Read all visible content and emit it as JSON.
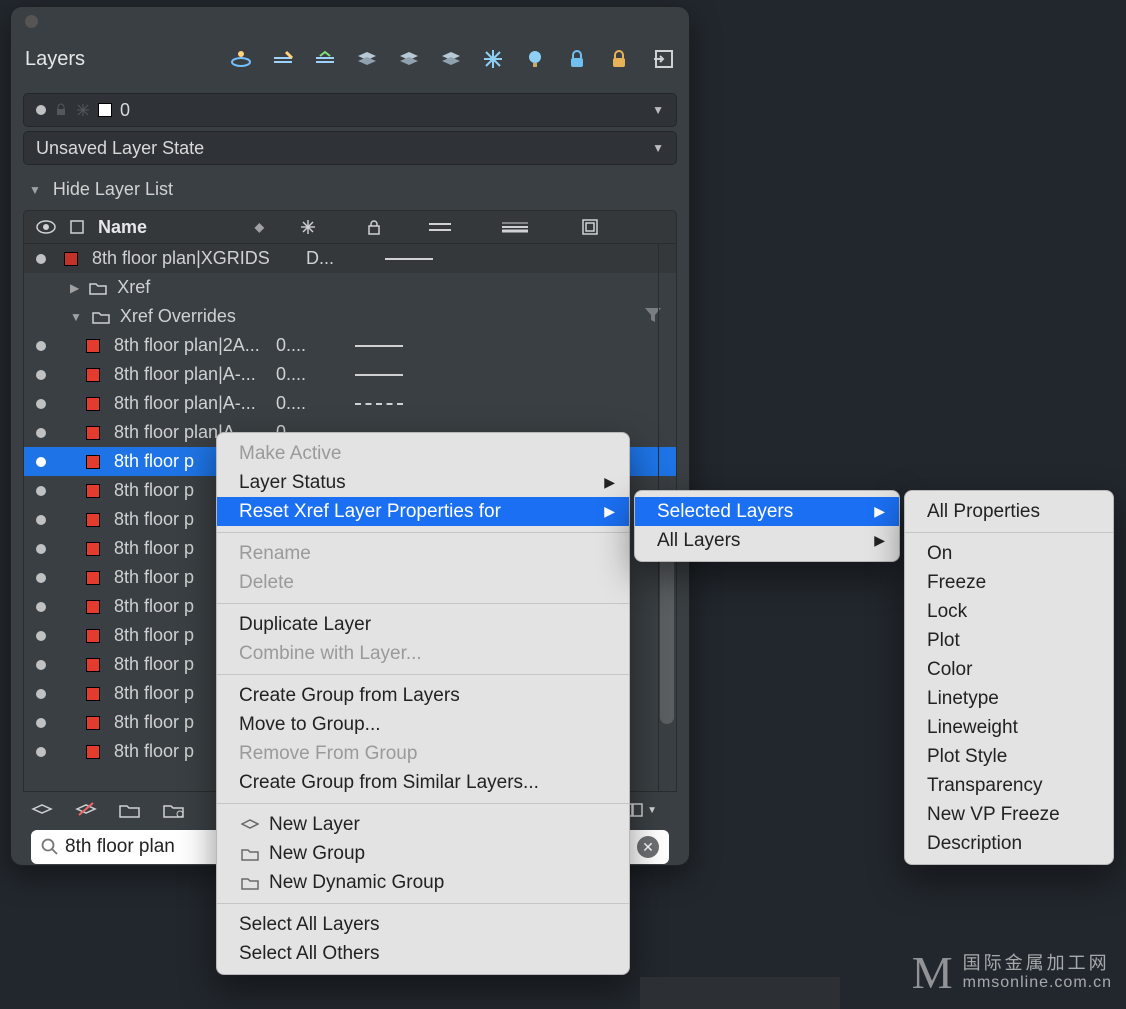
{
  "panel": {
    "title": "Layers",
    "layer_select": {
      "value": "0"
    },
    "state_select": {
      "value": "Unsaved Layer State"
    },
    "hide_label": "Hide Layer List",
    "columns": {
      "name": "Name"
    },
    "search": {
      "value": "8th floor plan"
    }
  },
  "tree": {
    "row0": {
      "label": "8th floor plan|XGRIDS",
      "d": "D..."
    },
    "xref_group": "Xref",
    "xref_overrides": "Xref Overrides",
    "rows": [
      {
        "label": "8th floor plan|2A...",
        "d": "0....",
        "line": "solid"
      },
      {
        "label": "8th floor plan|A-...",
        "d": "0....",
        "line": "solid"
      },
      {
        "label": "8th floor plan|A-...",
        "d": "0....",
        "line": "dash"
      },
      {
        "label": "8th floor plan|A-...",
        "d": "0....",
        "line": "solid"
      },
      {
        "label": "8th floor p",
        "d": "",
        "line": "",
        "selected": true
      },
      {
        "label": "8th floor p",
        "d": "",
        "line": ""
      },
      {
        "label": "8th floor p",
        "d": "",
        "line": ""
      },
      {
        "label": "8th floor p",
        "d": "",
        "line": ""
      },
      {
        "label": "8th floor p",
        "d": "",
        "line": ""
      },
      {
        "label": "8th floor p",
        "d": "",
        "line": ""
      },
      {
        "label": "8th floor p",
        "d": "",
        "line": ""
      },
      {
        "label": "8th floor p",
        "d": "",
        "line": ""
      },
      {
        "label": "8th floor p",
        "d": "",
        "line": ""
      },
      {
        "label": "8th floor p",
        "d": "",
        "line": ""
      },
      {
        "label": "8th floor p",
        "d": "",
        "line": ""
      }
    ]
  },
  "context_menu": {
    "make_active": "Make Active",
    "layer_status": "Layer Status",
    "reset_xref": "Reset Xref Layer Properties for",
    "rename": "Rename",
    "delete": "Delete",
    "duplicate": "Duplicate Layer",
    "combine": "Combine with Layer...",
    "create_group": "Create Group from Layers",
    "move_group": "Move to Group...",
    "remove_group": "Remove From Group",
    "create_similar": "Create Group from Similar Layers...",
    "new_layer": "New Layer",
    "new_group": "New Group",
    "new_dyn_group": "New Dynamic Group",
    "select_all": "Select All Layers",
    "select_others": "Select All Others"
  },
  "submenu1": {
    "selected": "Selected Layers",
    "all": "All Layers"
  },
  "submenu2": {
    "all_props": "All Properties",
    "on": "On",
    "freeze": "Freeze",
    "lock": "Lock",
    "plot": "Plot",
    "color": "Color",
    "linetype": "Linetype",
    "lineweight": "Lineweight",
    "plot_style": "Plot Style",
    "transparency": "Transparency",
    "new_vp": "New VP Freeze",
    "description": "Description"
  },
  "watermark": {
    "cn": "国际金属加工网",
    "url": "mmsonline.com.cn"
  }
}
